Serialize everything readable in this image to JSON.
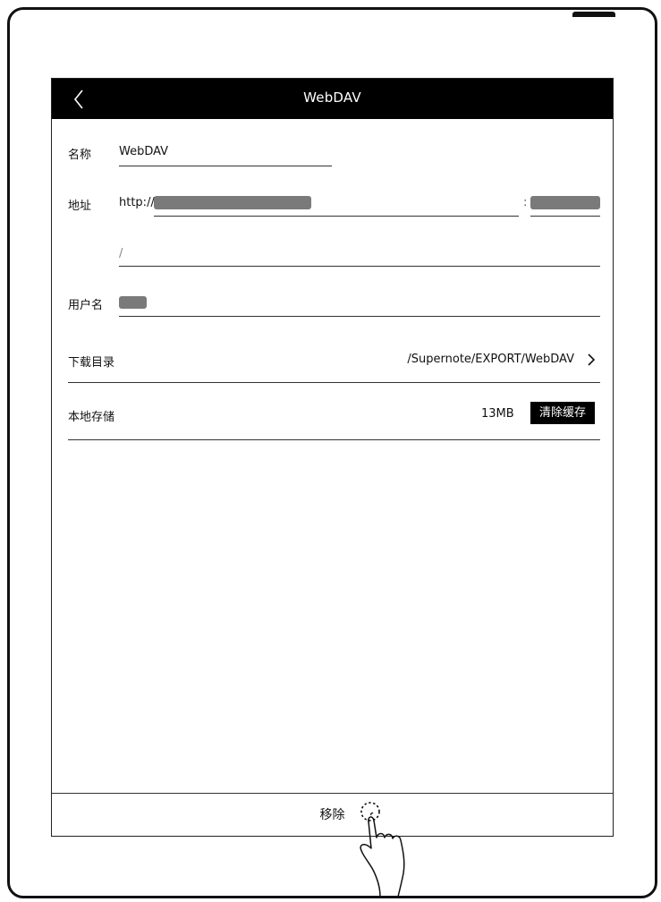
{
  "header": {
    "title": "WebDAV",
    "back_icon": "chevron-left-icon"
  },
  "form": {
    "name_label": "名称",
    "name_value": "WebDAV",
    "address_label": "地址",
    "address_prefix": "http://",
    "port_separator": ":",
    "path_placeholder": "/",
    "username_label": "用户名"
  },
  "download_dir": {
    "label": "下载目录",
    "value": "/Supernote/EXPORT/WebDAV",
    "chevron_icon": "chevron-right-icon"
  },
  "local_storage": {
    "label": "本地存储",
    "size": "13MB",
    "clear_button": "清除缓存"
  },
  "footer": {
    "remove_button": "移除"
  },
  "overlay": {
    "icon": "tap-hand-icon"
  },
  "colors": {
    "bar": "#000000",
    "redaction": "#7a7a7a",
    "line": "#333333"
  }
}
